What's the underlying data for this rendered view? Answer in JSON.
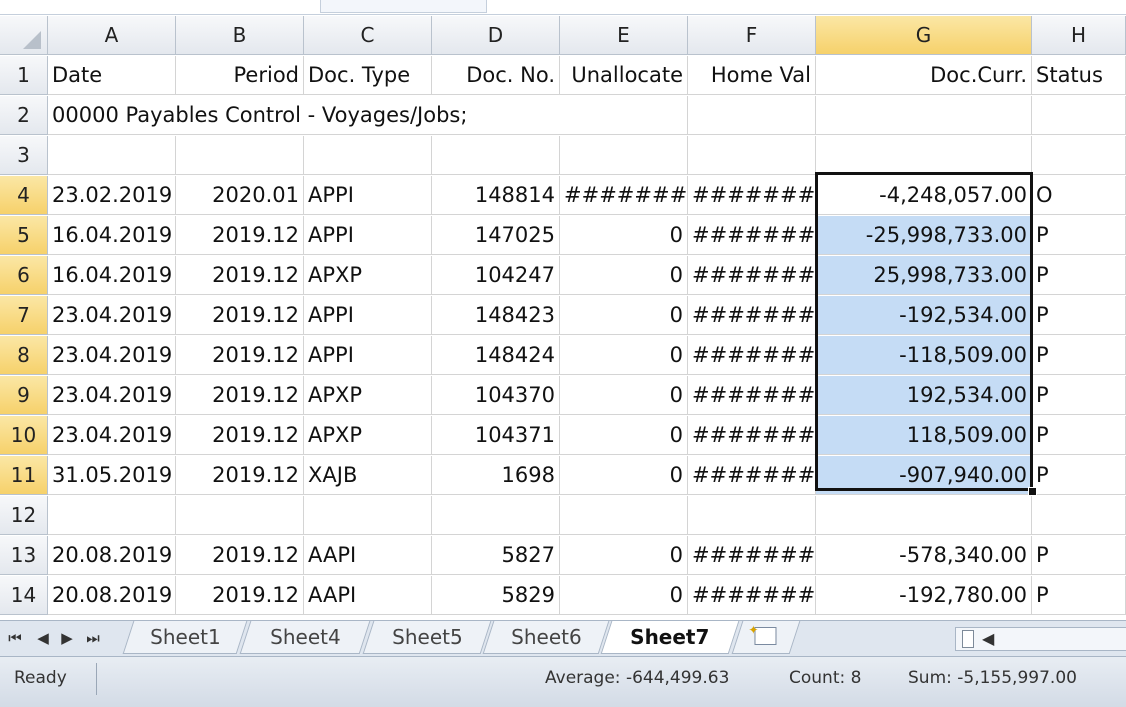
{
  "columns": [
    "A",
    "B",
    "C",
    "D",
    "E",
    "F",
    "G",
    "H"
  ],
  "selected_column": "G",
  "rows": [
    {
      "num": "1",
      "cells": [
        "Date",
        "Period",
        "Doc. Type",
        "Doc. No.",
        "Unallocate",
        "Home Val",
        "Doc.Curr.",
        "Status"
      ]
    },
    {
      "num": "2",
      "cells": [
        "00000 Payables Control - Voyages/Jobs;",
        "",
        "",
        "",
        "",
        "",
        "",
        ""
      ]
    },
    {
      "num": "3",
      "cells": [
        "",
        "",
        "",
        "",
        "",
        "",
        "",
        ""
      ]
    },
    {
      "num": "4",
      "cells": [
        "23.02.2019",
        "2020.01",
        "APPI",
        "148814",
        "########",
        "########",
        "-4,248,057.00",
        "O"
      ]
    },
    {
      "num": "5",
      "cells": [
        "16.04.2019",
        "2019.12",
        "APPI",
        "147025",
        "0",
        "########",
        "-25,998,733.00",
        "P"
      ]
    },
    {
      "num": "6",
      "cells": [
        "16.04.2019",
        "2019.12",
        "APXP",
        "104247",
        "0",
        "########",
        "25,998,733.00",
        "P"
      ]
    },
    {
      "num": "7",
      "cells": [
        "23.04.2019",
        "2019.12",
        "APPI",
        "148423",
        "0",
        "########",
        "-192,534.00",
        "P"
      ]
    },
    {
      "num": "8",
      "cells": [
        "23.04.2019",
        "2019.12",
        "APPI",
        "148424",
        "0",
        "########",
        "-118,509.00",
        "P"
      ]
    },
    {
      "num": "9",
      "cells": [
        "23.04.2019",
        "2019.12",
        "APXP",
        "104370",
        "0",
        "########",
        "192,534.00",
        "P"
      ]
    },
    {
      "num": "10",
      "cells": [
        "23.04.2019",
        "2019.12",
        "APXP",
        "104371",
        "0",
        "########",
        "118,509.00",
        "P"
      ]
    },
    {
      "num": "11",
      "cells": [
        "31.05.2019",
        "2019.12",
        "XAJB",
        "1698",
        "0",
        "########",
        "-907,940.00",
        "P"
      ]
    },
    {
      "num": "12",
      "cells": [
        "",
        "",
        "",
        "",
        "",
        "",
        "",
        ""
      ]
    },
    {
      "num": "13",
      "cells": [
        "20.08.2019",
        "2019.12",
        "AAPI",
        "5827",
        "0",
        "########",
        "-578,340.00",
        "P"
      ]
    },
    {
      "num": "14",
      "cells": [
        "20.08.2019",
        "2019.12",
        "AAPI",
        "5829",
        "0",
        "########",
        "-192,780.00",
        "P"
      ]
    }
  ],
  "selected_rows": [
    "4",
    "5",
    "6",
    "7",
    "8",
    "9",
    "10",
    "11"
  ],
  "sheet_tabs": [
    "Sheet1",
    "Sheet4",
    "Sheet5",
    "Sheet6",
    "Sheet7"
  ],
  "active_sheet": "Sheet7",
  "status": {
    "ready": "Ready",
    "average": "Average: -644,499.63",
    "count": "Count: 8",
    "sum": "Sum: -5,155,997.00"
  },
  "colors": {
    "selection_fill": "#c5dcf5",
    "selected_header": "#f6d16b"
  }
}
